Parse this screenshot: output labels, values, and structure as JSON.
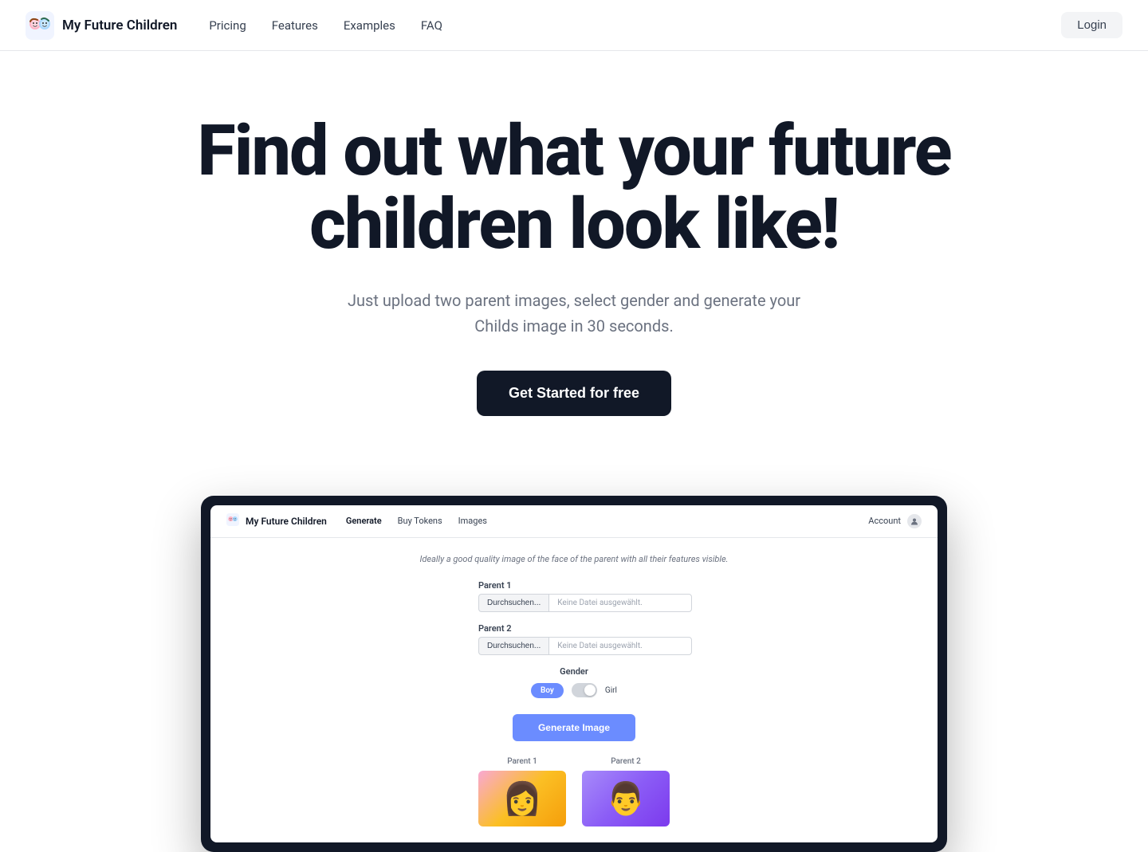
{
  "brand": {
    "logo_emoji": "🧒",
    "name": "My Future Children"
  },
  "navbar": {
    "links": [
      {
        "id": "pricing",
        "label": "Pricing"
      },
      {
        "id": "features",
        "label": "Features"
      },
      {
        "id": "examples",
        "label": "Examples"
      },
      {
        "id": "faq",
        "label": "FAQ"
      }
    ],
    "login_label": "Login"
  },
  "hero": {
    "title": "Find out what your future children look like!",
    "subtitle_line1": "Just upload two parent images, select gender and generate your",
    "subtitle_line2": "Childs image in 30 seconds.",
    "cta_label": "Get Started for free"
  },
  "app_preview": {
    "navbar": {
      "brand_name": "My Future Children",
      "links": [
        {
          "label": "Generate",
          "active": true
        },
        {
          "label": "Buy Tokens",
          "active": false
        },
        {
          "label": "Images",
          "active": false
        }
      ],
      "account_label": "Account"
    },
    "description": "Ideally a good quality image of the face of the parent with all their features visible.",
    "parent1_label": "Parent 1",
    "parent1_btn": "Durchsuchen...",
    "parent1_placeholder": "Keine Datei ausgewählt.",
    "parent2_label": "Parent 2",
    "parent2_btn": "Durchsuchen...",
    "parent2_placeholder": "Keine Datei ausgewählt.",
    "gender_label": "Gender",
    "gender_boy": "Boy",
    "gender_girl": "Girl",
    "generate_btn": "Generate Image",
    "parent1_photo_label": "Parent 1",
    "parent2_photo_label": "Parent 2"
  }
}
